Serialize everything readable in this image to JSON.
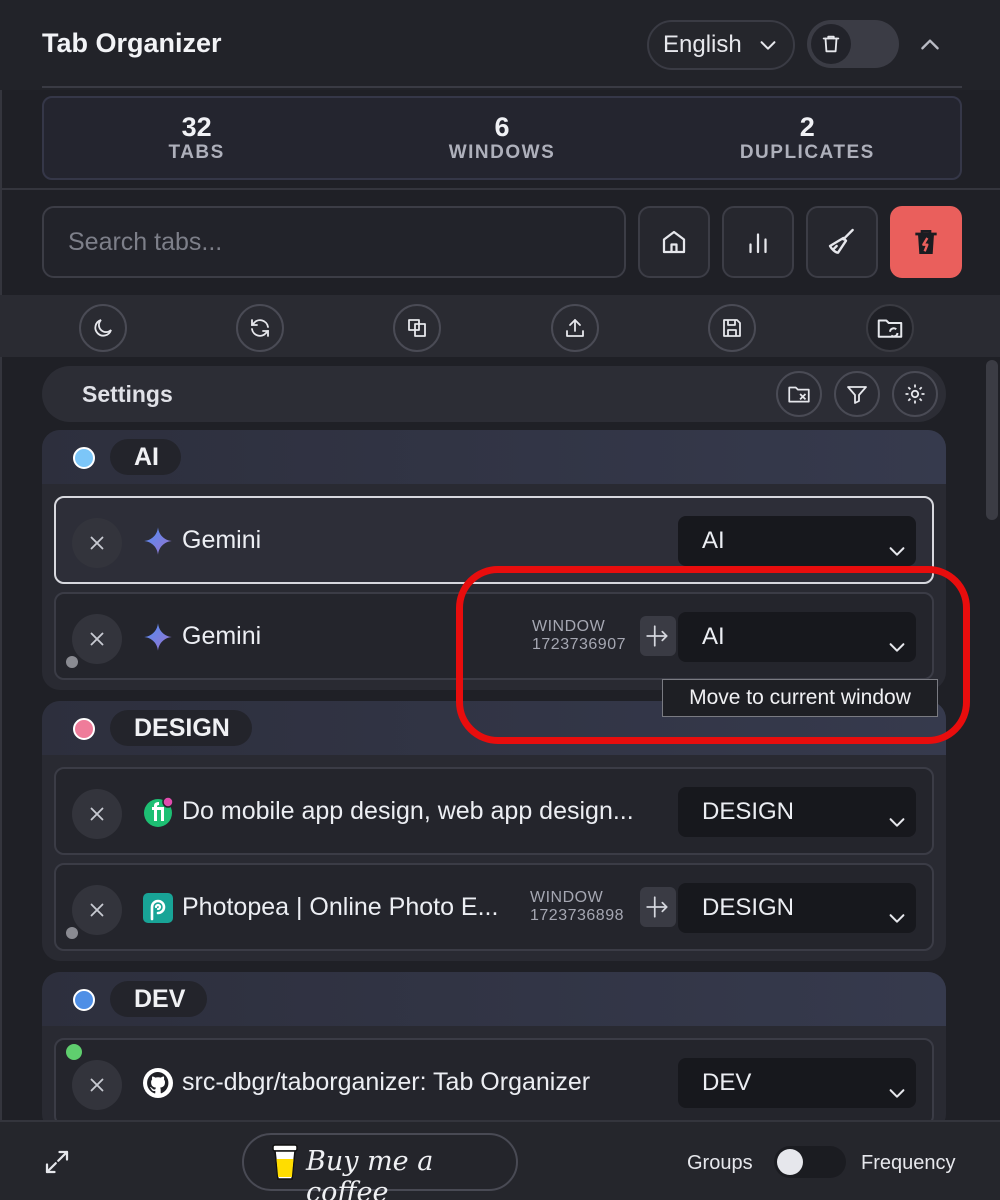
{
  "header": {
    "title": "Tab Organizer",
    "language": "English"
  },
  "stats": [
    {
      "value": "32",
      "label": "TABS"
    },
    {
      "value": "6",
      "label": "WINDOWS"
    },
    {
      "value": "2",
      "label": "DUPLICATES"
    }
  ],
  "search": {
    "placeholder": "Search tabs..."
  },
  "toolbar": {
    "icons": [
      "home-icon",
      "chart-icon",
      "broom-icon",
      "trash-bolt-icon"
    ],
    "danger_color": "#ea5f5c"
  },
  "action_bar": {
    "icons": [
      "moon-icon",
      "refresh-icon",
      "duplicate-icon",
      "upload-icon",
      "save-icon",
      "folder-sync-icon"
    ]
  },
  "settings": {
    "title": "Settings",
    "icons": [
      "folder-close-icon",
      "filter-icon",
      "gear-icon"
    ]
  },
  "groups": [
    {
      "name": "AI",
      "color": "#7cc6f8",
      "tabs": [
        {
          "title": "Gemini",
          "favicon": "gemini-icon",
          "group": "AI",
          "selected": true
        },
        {
          "title": "Gemini",
          "favicon": "gemini-icon",
          "group": "AI",
          "window_label": "WINDOW",
          "window_id": "1723736907"
        }
      ]
    },
    {
      "name": "DESIGN",
      "color": "#ef7c9a",
      "tabs": [
        {
          "title": "Do mobile app design, web app design...",
          "favicon": "fiverr-icon",
          "group": "DESIGN"
        },
        {
          "title": "Photopea | Online Photo E...",
          "favicon": "photopea-icon",
          "group": "DESIGN",
          "window_label": "WINDOW",
          "window_id": "1723736898"
        }
      ]
    },
    {
      "name": "DEV",
      "color": "#4f8fe6",
      "tabs": [
        {
          "title": "src-dbgr/taborganizer: Tab Organizer",
          "favicon": "github-icon",
          "group": "DEV"
        }
      ]
    }
  ],
  "tooltip": {
    "text": "Move to current window"
  },
  "annotation": {
    "color": "#e80d0d"
  },
  "footer": {
    "coffee": "Buy me a coffee",
    "left_mode": "Groups",
    "right_mode": "Frequency"
  }
}
